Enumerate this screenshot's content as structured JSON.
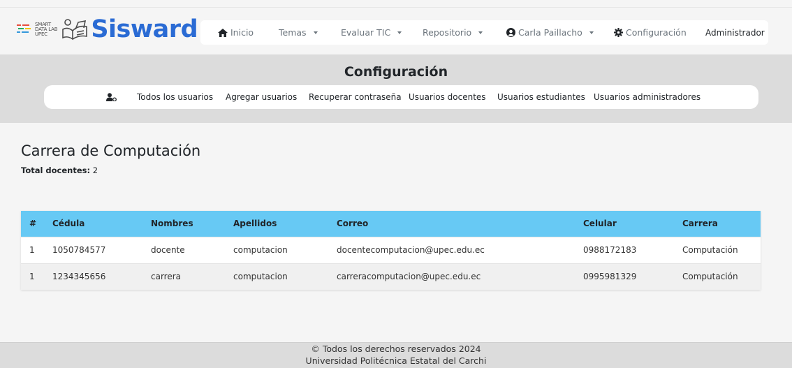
{
  "brand": {
    "smart_lines": [
      "SMART",
      "DATA LAB",
      "UPEC"
    ],
    "name": "Sisward",
    "accent_color": "#2a6bd4"
  },
  "nav": {
    "inicio": "Inicio",
    "temas": "Temas",
    "evaluar": "Evaluar TIC",
    "repositorio": "Repositorio",
    "user": "Carla Paillacho",
    "config": "Configuración",
    "role": "Administrador"
  },
  "subheader": {
    "title": "Configuración",
    "links": [
      "Todos los usuarios",
      "Agregar usuarios",
      "Recuperar contraseña",
      "Usuarios docentes",
      "Usuarios estudiantes",
      "Usuarios administradores"
    ]
  },
  "main": {
    "title": "Carrera de Computación",
    "total_label": "Total docentes:",
    "total_value": "2"
  },
  "table": {
    "header_color": "#67c9f4",
    "columns": [
      "#",
      "Cédula",
      "Nombres",
      "Apellidos",
      "Correo",
      "Celular",
      "Carrera"
    ],
    "rows": [
      [
        "1",
        "1050784577",
        "docente",
        "computacion",
        "docentecomputacion@upec.edu.ec",
        "0988172183",
        "Computación"
      ],
      [
        "1",
        "1234345656",
        "carrera",
        "computacion",
        "carreracomputacion@upec.edu.ec",
        "0995981329",
        "Computación"
      ]
    ]
  },
  "footer": {
    "line1": "© Todos los derechos reservados 2024",
    "line2": "Universidad Politécnica Estatal del Carchi"
  }
}
